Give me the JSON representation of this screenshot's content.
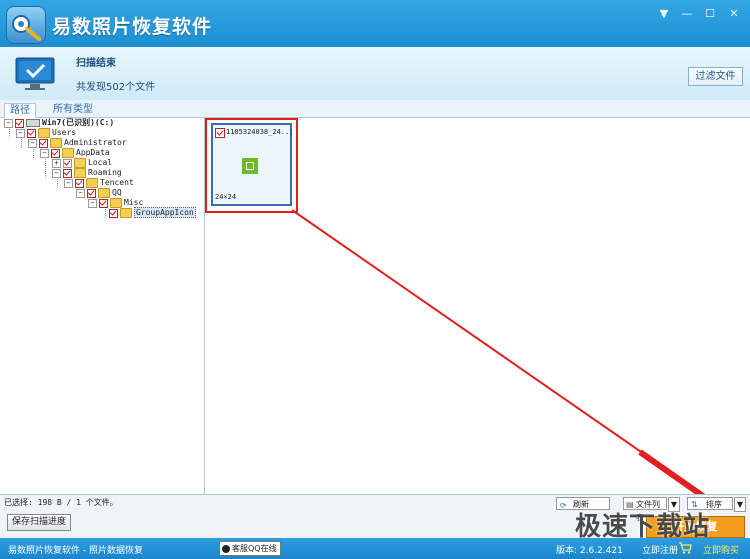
{
  "window": {
    "title": "易数照片恢复软件"
  },
  "banner": {
    "scan_title": "扫描结束",
    "scan_found": "共发现502个文件",
    "filter_label": "过滤文件"
  },
  "tabs": [
    {
      "label": "路径"
    },
    {
      "label": "所有类型"
    }
  ],
  "tree": [
    {
      "label": "Win7(已识别)(C:)"
    },
    {
      "label": "Users"
    },
    {
      "label": "Administrator"
    },
    {
      "label": "AppData"
    },
    {
      "label": "Local"
    },
    {
      "label": "Roaming"
    },
    {
      "label": "Tencent"
    },
    {
      "label": "QQ"
    },
    {
      "label": "Misc"
    },
    {
      "label": "GroupAppIcon"
    }
  ],
  "thumbnail": {
    "filename": "1105324038_24...",
    "dimensions": "24×24",
    "checked": true
  },
  "bottom": {
    "selection_info": "已选择: 198 B / 1 个文件。",
    "save_progress": "保存扫描进度",
    "refresh": "刷新",
    "view_mode": "文件列表",
    "sort": "排序",
    "recover": "开始恢复"
  },
  "status": {
    "left": "易数照片恢复软件 - 照片数据恢复",
    "qq": "客服QQ在线",
    "version": "版本: 2.6.2.421",
    "register": "立即注册",
    "buy": "立即购买"
  },
  "watermark": "极速下载站",
  "colors": {
    "title_bar": "#1c8fd2",
    "highlight": "#e02020",
    "recover_button": "#f59d1e"
  }
}
